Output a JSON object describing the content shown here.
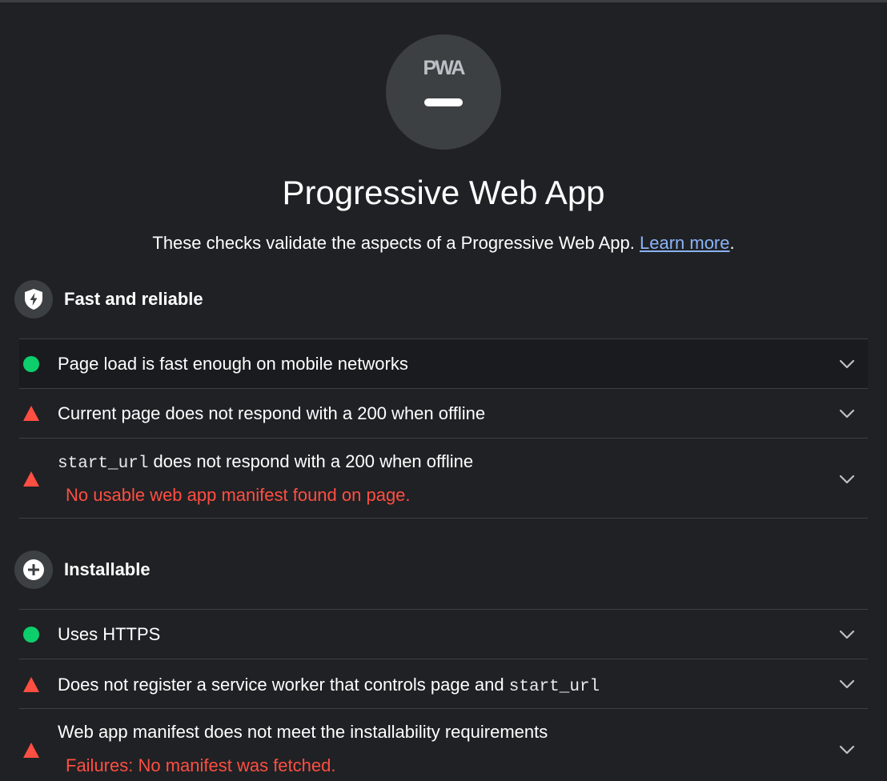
{
  "gauge": {
    "label": "PWA"
  },
  "title": "Progressive Web App",
  "description": {
    "text": "These checks validate the aspects of a Progressive Web App.",
    "link": "Learn more",
    "suffix": "."
  },
  "groups": [
    {
      "title": "Fast and reliable",
      "icon": "shield-lightning-icon",
      "audits": [
        {
          "status": "pass",
          "title": "Page load is fast enough on mobile networks"
        },
        {
          "status": "fail",
          "title": "Current page does not respond with a 200 when offline"
        },
        {
          "status": "fail",
          "code": "start_url",
          "title": " does not respond with a 200 when offline",
          "error": "No usable web app manifest found on page."
        }
      ]
    },
    {
      "title": "Installable",
      "icon": "plus-circle-icon",
      "audits": [
        {
          "status": "pass",
          "title": "Uses HTTPS"
        },
        {
          "status": "fail",
          "title": "Does not register a service worker that controls page and ",
          "code": "start_url"
        },
        {
          "status": "fail",
          "title": "Web app manifest does not meet the installability requirements",
          "error": "Failures: No manifest was fetched."
        }
      ]
    }
  ],
  "colors": {
    "pass": "#0cce6b",
    "fail": "#ff4e42",
    "link": "#8ab4f8",
    "background": "#202124"
  }
}
